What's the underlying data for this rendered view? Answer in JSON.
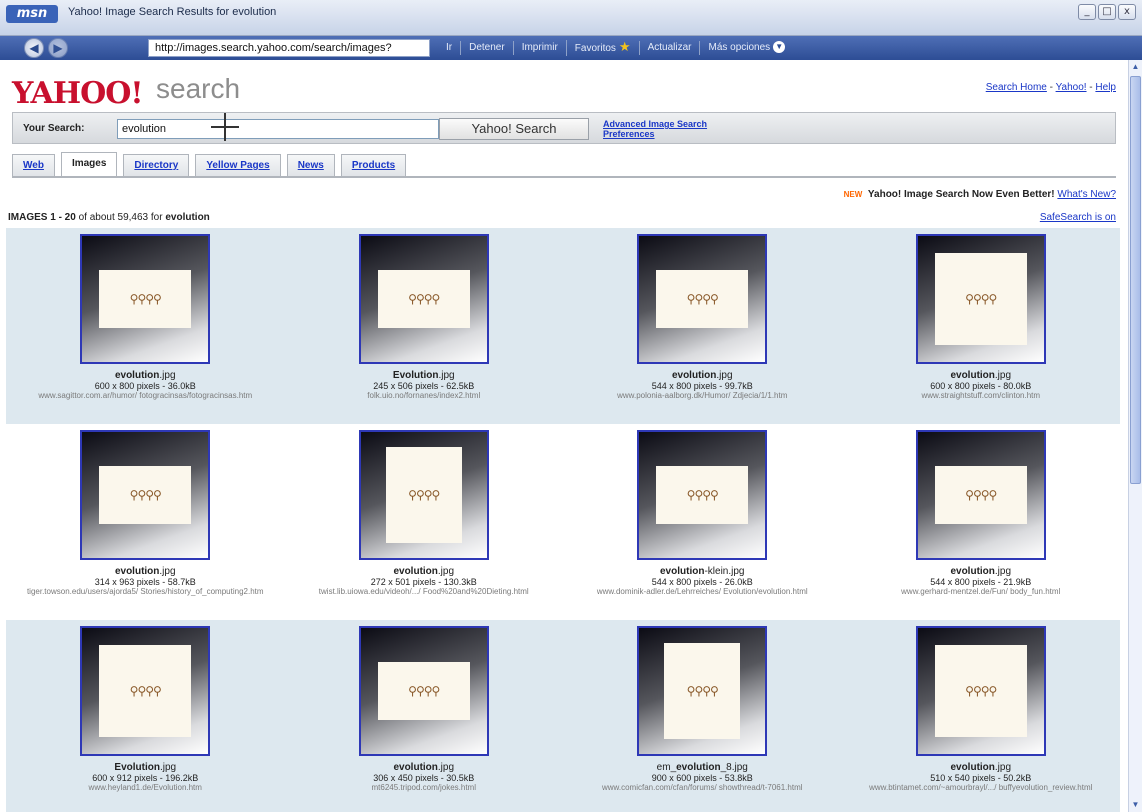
{
  "window": {
    "title": "Yahoo! Image Search Results for evolution",
    "logo": "msn",
    "controls": [
      "_",
      "□",
      "x"
    ]
  },
  "navbar": {
    "back_icon": "back-arrow-icon",
    "forward_icon": "forward-arrow-icon",
    "url": "http://images.search.yahoo.com/search/images?",
    "items": [
      "Ir",
      "Detener",
      "Imprimir",
      "Favoritos",
      "Actualizar",
      "Más opciones"
    ]
  },
  "header": {
    "logo": "YAHOO!",
    "logo_suffix": "search",
    "links": [
      "Search Home",
      "Yahoo!",
      "Help"
    ]
  },
  "search": {
    "label": "Your Search:",
    "value": "evolution",
    "button": "Yahoo! Search",
    "advanced": "Advanced Image Search",
    "preferences": "Preferences"
  },
  "tabs": [
    "Web",
    "Images",
    "Directory",
    "Yellow Pages",
    "News",
    "Products"
  ],
  "active_tab": "Images",
  "announcement": {
    "badge": "NEW",
    "text": "Yahoo! Image Search Now Even Better!",
    "link": "What's New?"
  },
  "results": {
    "prefix": "IMAGES 1 - 20",
    "middle": "of about 59,463 for",
    "query": "evolution",
    "safesearch": "SafeSearch is on",
    "rows": [
      [
        {
          "name_bold": "evolution",
          "name_rest": ".jpg",
          "size": "600 x 800 pixels - 36.0kB",
          "url": "www.sagittor.com.ar/humor/ fotogracinsas/fotogracinsas.htm"
        },
        {
          "name_bold": "Evolution",
          "name_rest": ".jpg",
          "size": "245 x 506 pixels - 62.5kB",
          "url": "folk.uio.no/fornanes/index2.html"
        },
        {
          "name_bold": "evolution",
          "name_rest": ".jpg",
          "size": "544 x 800 pixels - 99.7kB",
          "url": "www.polonia-aalborg.dk/Humor/ Zdjecia/1/1.htm"
        },
        {
          "name_bold": "evolution",
          "name_rest": ".jpg",
          "size": "600 x 800 pixels - 80.0kB",
          "url": "www.straightstuff.com/clinton.htm"
        }
      ],
      [
        {
          "name_bold": "evolution",
          "name_rest": ".jpg",
          "size": "314 x 963 pixels - 58.7kB",
          "url": "tiger.towson.edu/users/ajorda5/ Stories/history_of_computing2.htm"
        },
        {
          "name_bold": "evolution",
          "name_rest": ".jpg",
          "size": "272 x 501 pixels - 130.3kB",
          "url": "twist.lib.uiowa.edu/videoh/.../ Food%20and%20Dieting.html"
        },
        {
          "name_bold": "evolution",
          "name_rest": "-klein.jpg",
          "size": "544 x 800 pixels - 26.0kB",
          "url": "www.dominik-adler.de/Lehrreiches/ Evolution/evolution.html"
        },
        {
          "name_bold": "evolution",
          "name_rest": ".jpg",
          "size": "544 x 800 pixels - 21.9kB",
          "url": "www.gerhard-mentzel.de/Fun/ body_fun.html"
        }
      ],
      [
        {
          "name_bold": "Evolution",
          "name_rest": ".jpg",
          "size": "600 x 912 pixels - 196.2kB",
          "url": "www.heyland1.de/Evolution.htm"
        },
        {
          "name_bold": "evolution",
          "name_rest": ".jpg",
          "size": "306 x 450 pixels - 30.5kB",
          "url": "mt6245.tripod.com/jokes.html"
        },
        {
          "name_pre": "em_",
          "name_bold": "evolution",
          "name_rest": "_8.jpg",
          "size": "900 x 600 pixels - 53.8kB",
          "url": "www.comicfan.com/cfan/forums/ showthread/t-7061.html"
        },
        {
          "name_bold": "evolution",
          "name_rest": ".jpg",
          "size": "510 x 540 pixels - 50.2kB",
          "url": "www.btintamet.com/~amourbrayl/.../ buffyevolution_review.html"
        }
      ]
    ]
  },
  "colors": {
    "yahoo_red": "#c8102e",
    "link_blue": "#1a37c7",
    "thumb_border": "#2e38b6",
    "row_shade": "#dde8ef"
  }
}
